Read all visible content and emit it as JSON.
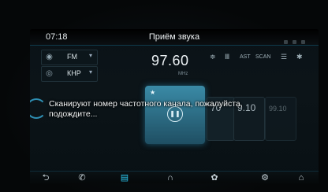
{
  "statusbar": {
    "time": "07:18",
    "title": "Приём звука"
  },
  "selectors": [
    {
      "icon": "antenna-icon",
      "label": "FM"
    },
    {
      "icon": "radio-icon",
      "label": "КНР"
    }
  ],
  "frequency": {
    "value": "97.60",
    "unit": "MHz"
  },
  "controls": {
    "eq_label": "≑",
    "bars_label": "Ⅲ",
    "ast_label": "AST",
    "scan_label": "SCAN"
  },
  "presets": [
    "70",
    "9.10",
    "99.10"
  ],
  "scan_message": "Сканируют номер частотного канала, пожалуйста, подождите...",
  "dock": [
    "back",
    "phone",
    "radio",
    "music",
    "settings-a",
    "settings",
    "home"
  ]
}
